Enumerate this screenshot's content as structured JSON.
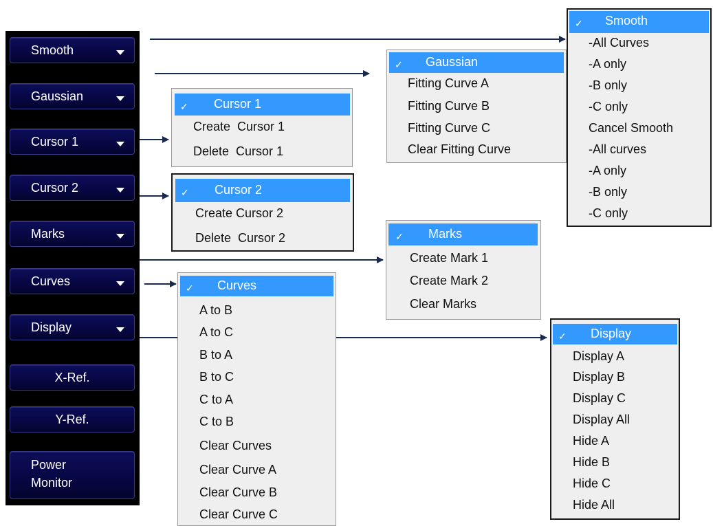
{
  "colors": {
    "panel": "#000000",
    "button": "#07074a",
    "highlight": "#3399ff",
    "menu_bg": "#efefef",
    "arrow": "#1a2a4e"
  },
  "check_glyph": "✓",
  "buttons": {
    "smooth": "Smooth",
    "gaussian": "Gaussian",
    "cursor1": "Cursor 1",
    "cursor2": "Cursor 2",
    "marks": "Marks",
    "curves": "Curves",
    "display": "Display",
    "xref": "X-Ref.",
    "yref": "Y-Ref.",
    "power_line1": "Power",
    "power_line2": "Monitor"
  },
  "menus": {
    "smooth": {
      "header": "Smooth",
      "items": [
        "-All Curves",
        "-A only",
        "-B only",
        "-C only",
        "Cancel Smooth",
        "-All curves",
        "-A only",
        "-B only",
        "-C only"
      ]
    },
    "gaussian": {
      "header": "Gaussian",
      "items": [
        "Fitting Curve A",
        "Fitting Curve B",
        "Fitting Curve C",
        "Clear Fitting Curve"
      ]
    },
    "cursor1": {
      "header": "Cursor 1",
      "items": [
        "Create  Cursor 1",
        "Delete  Cursor 1"
      ]
    },
    "cursor2": {
      "header": "Cursor 2",
      "items": [
        "Create Cursor 2",
        "Delete  Cursor 2"
      ]
    },
    "marks": {
      "header": "Marks",
      "items": [
        "Create Mark 1",
        "Create Mark 2",
        "Clear Marks"
      ]
    },
    "curves": {
      "header": "Curves",
      "items": [
        "A to B",
        "A to C",
        "B to A",
        "B to C",
        "C to A",
        "C to B",
        "Clear Curves",
        "Clear Curve A",
        "Clear Curve B",
        "Clear Curve C"
      ]
    },
    "display": {
      "header": "Display",
      "items": [
        "Display A",
        "Display B",
        "Display C",
        "Display All",
        "Hide A",
        "Hide B",
        "Hide C",
        "Hide All"
      ]
    }
  }
}
